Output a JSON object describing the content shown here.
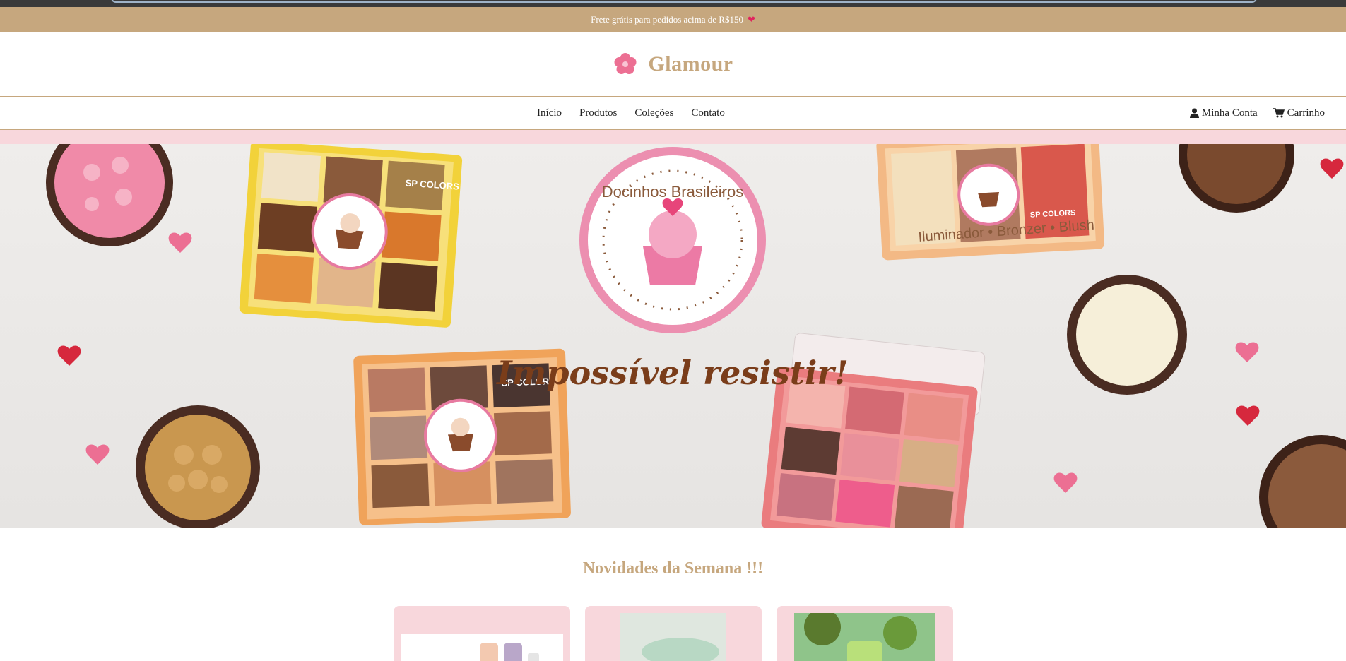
{
  "announcement": {
    "text": "Frete grátis para pedidos acima de R$150",
    "icon": "heart-icon"
  },
  "brand": {
    "name": "Glamour",
    "icon": "flower-icon",
    "color": "#c6a77e"
  },
  "nav": {
    "links": [
      "Início",
      "Produtos",
      "Coleções",
      "Contato"
    ],
    "account_label": "Minha Conta",
    "cart_label": "Carrinho"
  },
  "hero": {
    "badge_text": "Docinhos Brasileiros",
    "tagline": "Impossível resistir!",
    "subtitle": "Iluminador • Bronzer • Blush",
    "palette_brand": "SP COLORS"
  },
  "section": {
    "title": "Novidades da Semana !!!"
  },
  "colors": {
    "accent": "#c6a77e",
    "pink": "#f8d7dc",
    "topbar": "#3a3a3a"
  }
}
